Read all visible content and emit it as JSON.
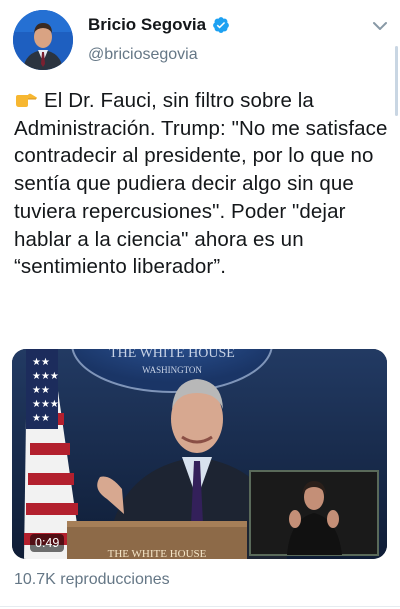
{
  "author": {
    "display_name": "Bricio Segovia",
    "handle": "@briciosegovia",
    "verified": true,
    "avatar_icon": "profile-photo"
  },
  "tweet": {
    "lead_icon": "backhand-index-pointing-right",
    "text": "El Dr. Fauci, sin filtro sobre la Administración. Trump: \"No me satisface contradecir al presidente, por lo que no sentía que pudiera decir algo sin que tuviera repercusiones\". Poder \"dejar hablar a la ciencia\" ahora es un “sentimiento liberador”."
  },
  "media": {
    "seal_top": "THE WHITE HOUSE",
    "seal_city": "WASHINGTON",
    "podium_text": "THE WHITE HOUSE",
    "duration": "0:49",
    "views": "10.7K reproducciones"
  },
  "colors": {
    "accent": "#1da1f2",
    "muted_text": "#657786"
  }
}
